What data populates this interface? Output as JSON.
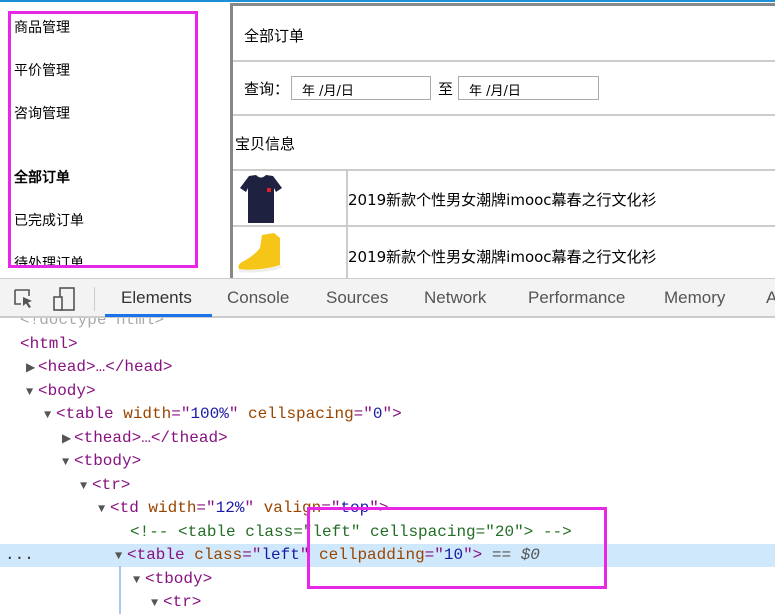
{
  "sidebar": {
    "items": [
      {
        "label": "商品管理",
        "bold": false
      },
      {
        "label": "平价管理",
        "bold": false
      },
      {
        "label": "咨询管理",
        "bold": false
      },
      {
        "label": "全部订单",
        "bold": true
      },
      {
        "label": "已完成订单",
        "bold": false
      },
      {
        "label": "待处理订单",
        "bold": false
      }
    ]
  },
  "main": {
    "title": "全部订单",
    "query_label": "查询：",
    "date_from": "年 /月/日",
    "to_label": "至",
    "date_to": "年 /月/日",
    "section_header": "宝贝信息",
    "products": [
      {
        "image": "t-shirt",
        "name": "2019新款个性男女潮牌imooc幕春之行文化衫"
      },
      {
        "image": "sneaker",
        "name": "2019新款个性男女潮牌imooc幕春之行文化衫"
      }
    ]
  },
  "devtools": {
    "tabs": [
      "Elements",
      "Console",
      "Sources",
      "Network",
      "Performance",
      "Memory",
      "A"
    ],
    "active_tab": "Elements",
    "selected_marker": "...",
    "lines": [
      {
        "tri": "",
        "tokens": [
          [
            "dim",
            "<!doctype html>"
          ]
        ]
      },
      {
        "tri": "",
        "tokens": [
          [
            "tag",
            "<html>"
          ]
        ]
      },
      {
        "tri": "▶",
        "tokens": [
          [
            "tag",
            "<head>"
          ],
          [
            "plain",
            "…"
          ],
          [
            "tag",
            "</head>"
          ]
        ]
      },
      {
        "tri": "▼",
        "tokens": [
          [
            "tag",
            "<body>"
          ]
        ]
      },
      {
        "tri": "▼",
        "tokens": [
          [
            "tag",
            "<table "
          ],
          [
            "attr",
            "width"
          ],
          [
            "tag",
            "=\""
          ],
          [
            "val",
            "100%"
          ],
          [
            "tag",
            "\" "
          ],
          [
            "attr",
            "cellspacing"
          ],
          [
            "tag",
            "=\""
          ],
          [
            "val",
            "0"
          ],
          [
            "tag",
            "\">"
          ]
        ]
      },
      {
        "tri": "▶",
        "tokens": [
          [
            "tag",
            "<thead>"
          ],
          [
            "plain",
            "…"
          ],
          [
            "tag",
            "</thead>"
          ]
        ]
      },
      {
        "tri": "▼",
        "tokens": [
          [
            "tag",
            "<tbody>"
          ]
        ]
      },
      {
        "tri": "▼",
        "tokens": [
          [
            "tag",
            "<tr>"
          ]
        ]
      },
      {
        "tri": "▼",
        "tokens": [
          [
            "tag",
            "<td "
          ],
          [
            "attr",
            "width"
          ],
          [
            "tag",
            "=\""
          ],
          [
            "val",
            "12%"
          ],
          [
            "tag",
            "\" "
          ],
          [
            "attr",
            "valign"
          ],
          [
            "tag",
            "=\""
          ],
          [
            "val",
            "top"
          ],
          [
            "tag",
            "\">"
          ]
        ]
      },
      {
        "tri": "",
        "tokens": [
          [
            "com",
            "<!-- <table class=\"left\" cellspacing=\"20\"> -->"
          ]
        ]
      },
      {
        "tri": "▼",
        "tokens": [
          [
            "tag",
            "<table "
          ],
          [
            "attr",
            "class"
          ],
          [
            "tag",
            "=\""
          ],
          [
            "val",
            "left"
          ],
          [
            "tag",
            "\" "
          ],
          [
            "attr",
            "cellpadding"
          ],
          [
            "tag",
            "=\""
          ],
          [
            "val",
            "10"
          ],
          [
            "tag",
            "\">"
          ],
          [
            "eq",
            " == $0"
          ]
        ]
      },
      {
        "tri": "▼",
        "tokens": [
          [
            "tag",
            "<tbody>"
          ]
        ]
      },
      {
        "tri": "▼",
        "tokens": [
          [
            "tag",
            "<tr>"
          ]
        ]
      }
    ]
  },
  "colors": {
    "highlight_box": "#e826e8",
    "active_tab_underline": "#1a73e8",
    "selected_row": "#cfe8fc"
  }
}
